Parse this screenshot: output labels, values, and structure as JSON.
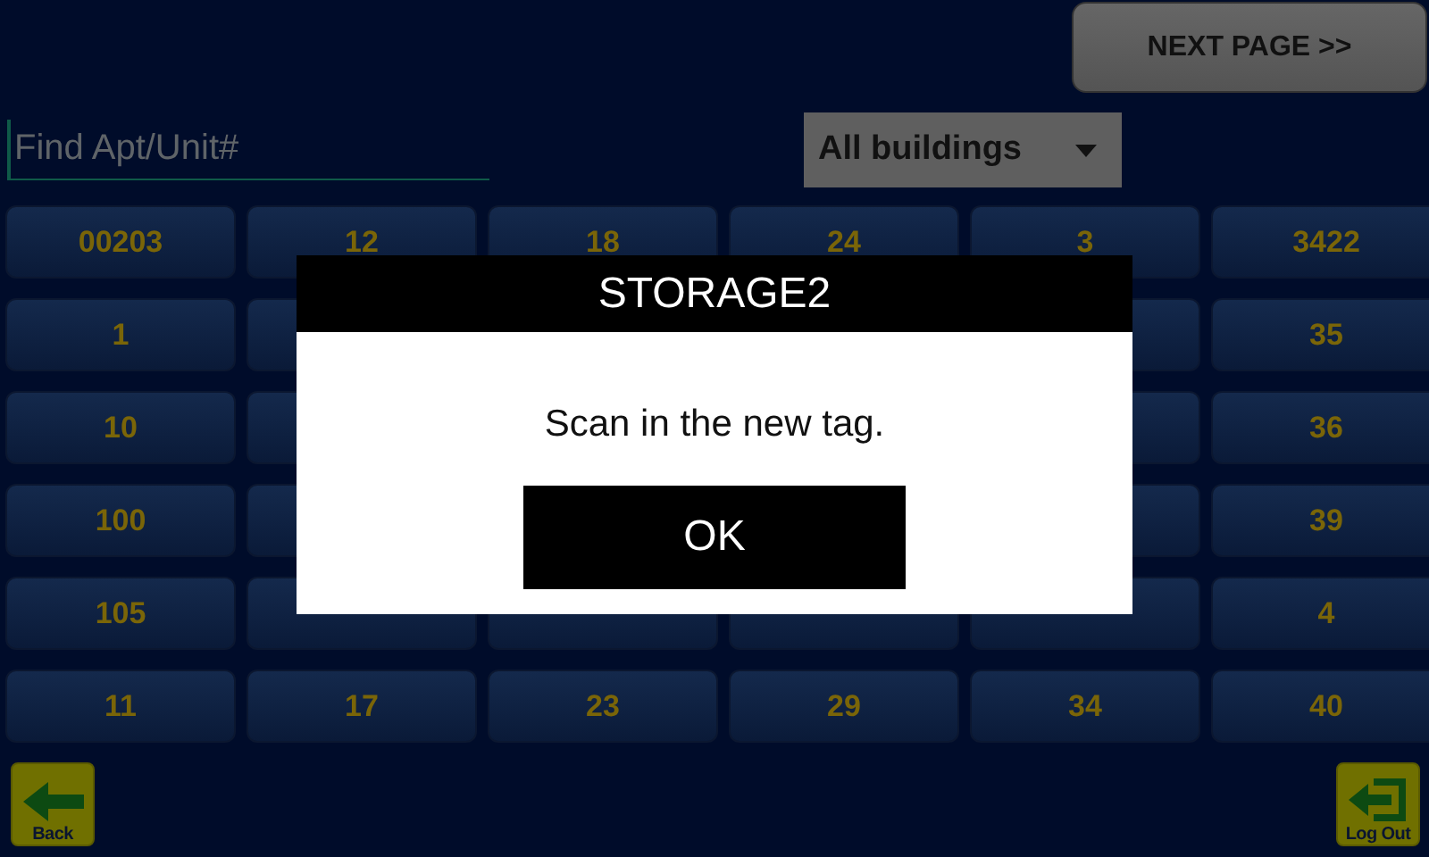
{
  "next_button": {
    "label": "NEXT PAGE >>"
  },
  "search": {
    "placeholder": "Find Apt/Unit#"
  },
  "building_filter": {
    "value": "All buildings"
  },
  "units": [
    [
      {
        "kind": "unit",
        "label": "00203"
      },
      {
        "kind": "unit",
        "label": "12"
      },
      {
        "kind": "unit",
        "label": "18"
      },
      {
        "kind": "unit",
        "label": "24"
      },
      {
        "kind": "unit",
        "label": "3"
      },
      {
        "kind": "unit",
        "label": "3422"
      }
    ],
    [
      {
        "kind": "unit",
        "label": "1"
      },
      {
        "kind": "covered"
      },
      {
        "kind": "hidden"
      },
      {
        "kind": "hidden"
      },
      {
        "kind": "covered"
      },
      {
        "kind": "unit",
        "label": "35"
      }
    ],
    [
      {
        "kind": "unit",
        "label": "10"
      },
      {
        "kind": "covered"
      },
      {
        "kind": "hidden"
      },
      {
        "kind": "hidden"
      },
      {
        "kind": "covered"
      },
      {
        "kind": "unit",
        "label": "36"
      }
    ],
    [
      {
        "kind": "unit",
        "label": "100"
      },
      {
        "kind": "covered"
      },
      {
        "kind": "hidden"
      },
      {
        "kind": "hidden"
      },
      {
        "kind": "covered"
      },
      {
        "kind": "unit",
        "label": "39"
      }
    ],
    [
      {
        "kind": "unit",
        "label": "105"
      },
      {
        "kind": "covered"
      },
      {
        "kind": "covered"
      },
      {
        "kind": "covered"
      },
      {
        "kind": "covered"
      },
      {
        "kind": "unit",
        "label": "4"
      }
    ],
    [
      {
        "kind": "unit",
        "label": "11"
      },
      {
        "kind": "unit",
        "label": "17"
      },
      {
        "kind": "unit",
        "label": "23"
      },
      {
        "kind": "unit",
        "label": "29"
      },
      {
        "kind": "unit",
        "label": "34"
      },
      {
        "kind": "unit",
        "label": "40"
      }
    ]
  ],
  "back_button": {
    "label": "Back"
  },
  "logout_button": {
    "label": "Log Out"
  },
  "dialog": {
    "title": "STORAGE2",
    "message": "Scan in the new tag.",
    "button": "OK"
  }
}
